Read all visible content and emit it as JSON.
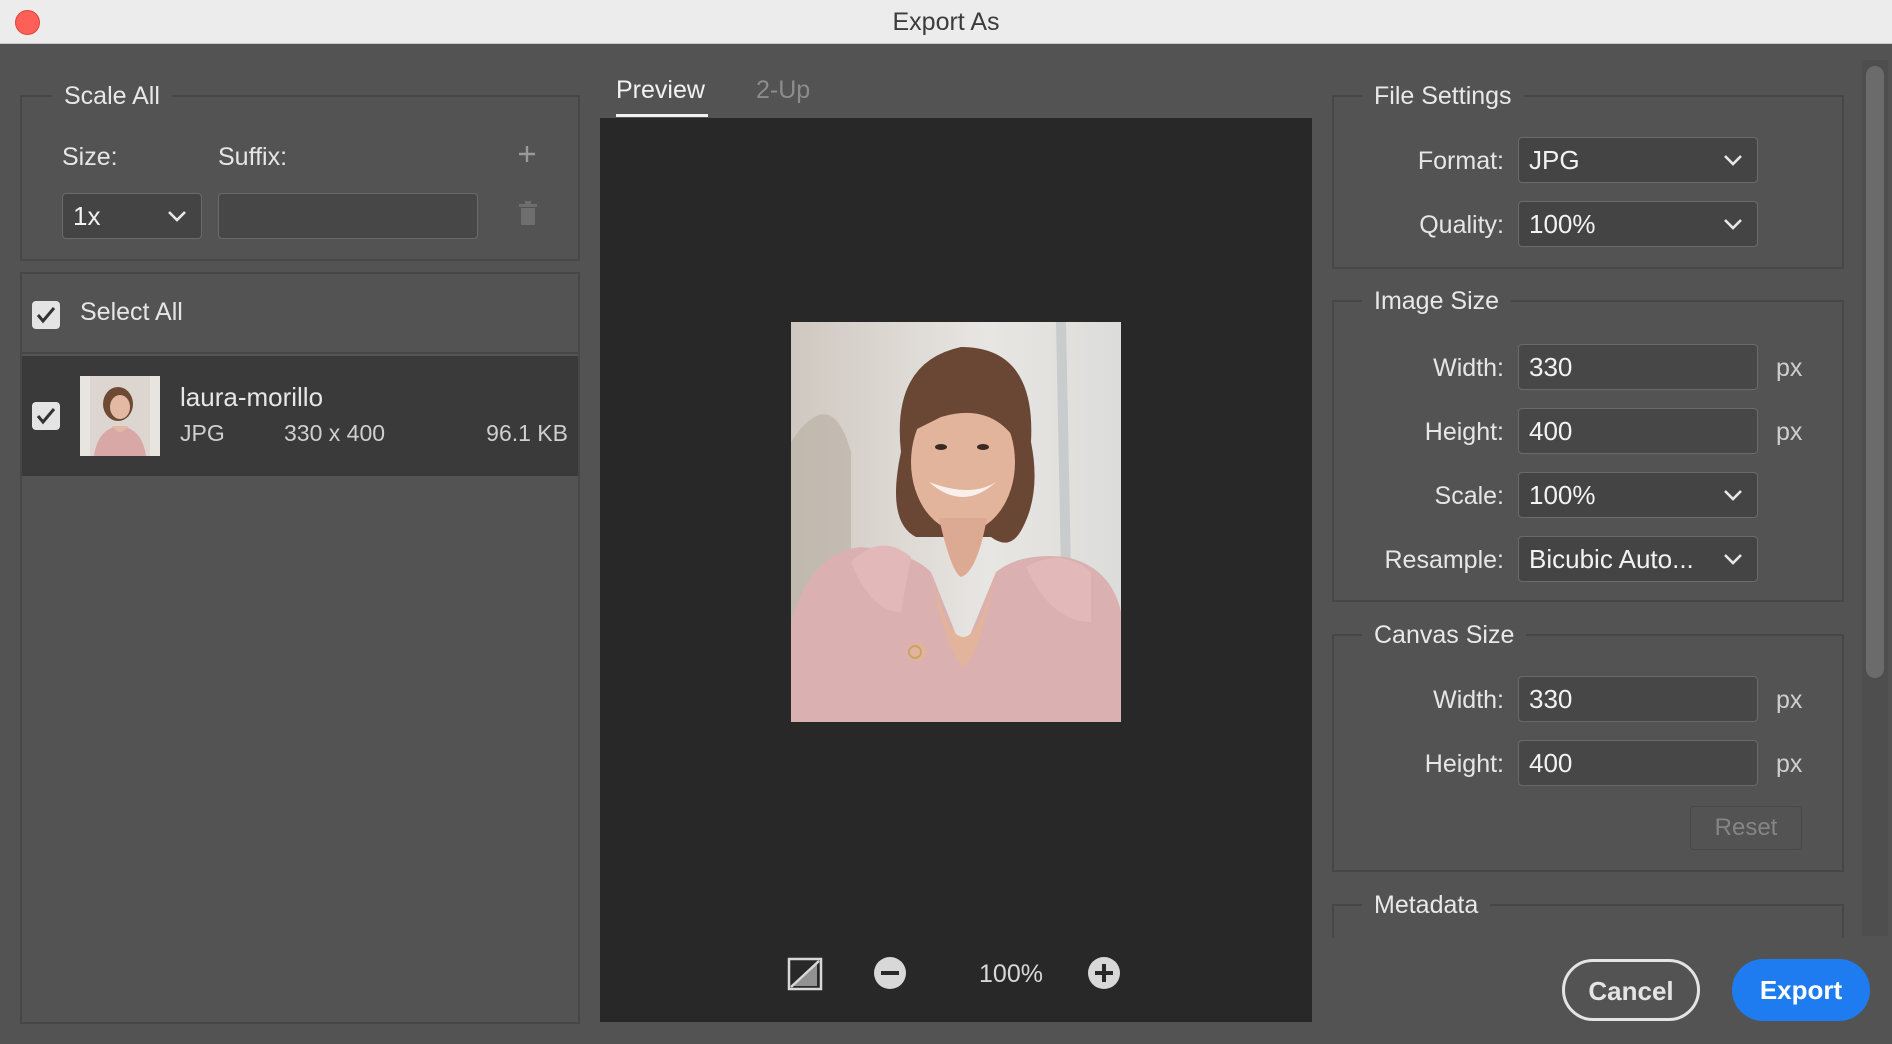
{
  "window": {
    "title": "Export As"
  },
  "left_panel": {
    "scale_all": {
      "title": "Scale All",
      "size_label": "Size:",
      "suffix_label": "Suffix:",
      "size_value": "1x",
      "suffix_value": ""
    },
    "select_all": {
      "label": "Select All",
      "checked": true
    },
    "files": [
      {
        "name": "laura-morillo",
        "format": "JPG",
        "dimensions": "330 x 400",
        "size": "96.1 KB",
        "checked": true
      }
    ]
  },
  "preview": {
    "tabs": [
      {
        "label": "Preview",
        "active": true
      },
      {
        "label": "2-Up",
        "active": false
      }
    ],
    "zoom": "100%"
  },
  "file_settings": {
    "title": "File Settings",
    "format_label": "Format:",
    "format_value": "JPG",
    "quality_label": "Quality:",
    "quality_value": "100%"
  },
  "image_size": {
    "title": "Image Size",
    "width_label": "Width:",
    "width_value": "330",
    "height_label": "Height:",
    "height_value": "400",
    "scale_label": "Scale:",
    "scale_value": "100%",
    "resample_label": "Resample:",
    "resample_value": "Bicubic Auto...",
    "unit": "px"
  },
  "canvas_size": {
    "title": "Canvas Size",
    "width_label": "Width:",
    "width_value": "330",
    "height_label": "Height:",
    "height_value": "400",
    "unit": "px",
    "reset_label": "Reset"
  },
  "metadata": {
    "title": "Metadata"
  },
  "actions": {
    "cancel_label": "Cancel",
    "export_label": "Export"
  },
  "colors": {
    "accent": "#1f7cf0",
    "background": "#535353",
    "preview_bg": "#282828"
  }
}
